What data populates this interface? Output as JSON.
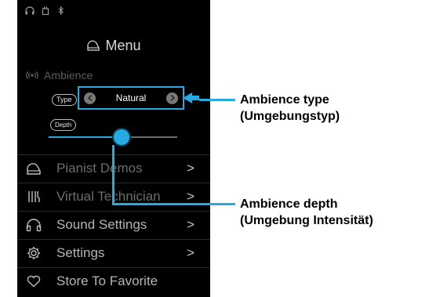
{
  "menu": {
    "title": "Menu"
  },
  "ambience": {
    "heading": "Ambience",
    "type_label": "Type",
    "depth_label": "Depth",
    "type_value": "Natural",
    "depth_fraction": 0.57
  },
  "menu_items": [
    {
      "label": "Pianist Demos",
      "icon": "piano-icon",
      "chevron": ">"
    },
    {
      "label": "Virtual Technician",
      "icon": "technician-icon",
      "chevron": ">"
    },
    {
      "label": "Sound Settings",
      "icon": "headphones-icon",
      "chevron": ">"
    },
    {
      "label": "Settings",
      "icon": "gear-icon",
      "chevron": ">"
    },
    {
      "label": "Store To Favorite",
      "icon": "heart-icon"
    }
  ],
  "callouts": {
    "type_line1": "Ambience type",
    "type_line2": "(Umgebungstyp)",
    "depth_line1": "Ambience depth",
    "depth_line2": "(Umgebung Intensität)"
  },
  "colors": {
    "accent": "#27a9e1",
    "background": "#000000"
  }
}
